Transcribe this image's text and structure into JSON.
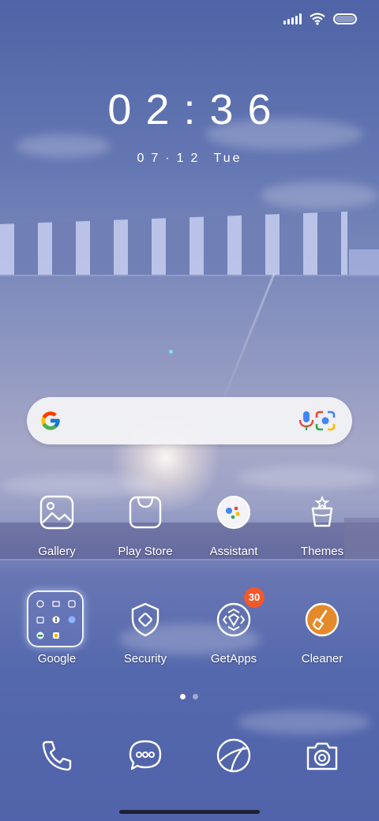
{
  "status_bar": {
    "signal_icon": "signal-bars-icon",
    "wifi_icon": "wifi-icon",
    "battery_icon": "battery-icon"
  },
  "clock": {
    "time": "02:36",
    "date_numeric": "07·12",
    "weekday": "Tue"
  },
  "search": {
    "google_icon": "google-g-icon",
    "mic_icon": "mic-icon",
    "lens_icon": "google-lens-icon"
  },
  "apps_row1": [
    {
      "label": "Gallery",
      "icon": "gallery-icon"
    },
    {
      "label": "Play Store",
      "icon": "play-store-icon"
    },
    {
      "label": "Assistant",
      "icon": "assistant-icon"
    },
    {
      "label": "Themes",
      "icon": "themes-icon"
    }
  ],
  "apps_row2": [
    {
      "label": "Google",
      "icon": "google-folder-icon"
    },
    {
      "label": "Security",
      "icon": "security-icon"
    },
    {
      "label": "GetApps",
      "icon": "getapps-icon",
      "badge": "30"
    },
    {
      "label": "Cleaner",
      "icon": "cleaner-icon"
    }
  ],
  "dock": [
    {
      "icon": "phone-icon"
    },
    {
      "icon": "messages-icon"
    },
    {
      "icon": "browser-icon"
    },
    {
      "icon": "camera-icon"
    }
  ],
  "pager": {
    "pages": 2,
    "active": 1
  },
  "colors": {
    "badge": "#f1582b",
    "search_bg": "#f2f2f6",
    "cleaner_accent": "#e58a2a"
  }
}
